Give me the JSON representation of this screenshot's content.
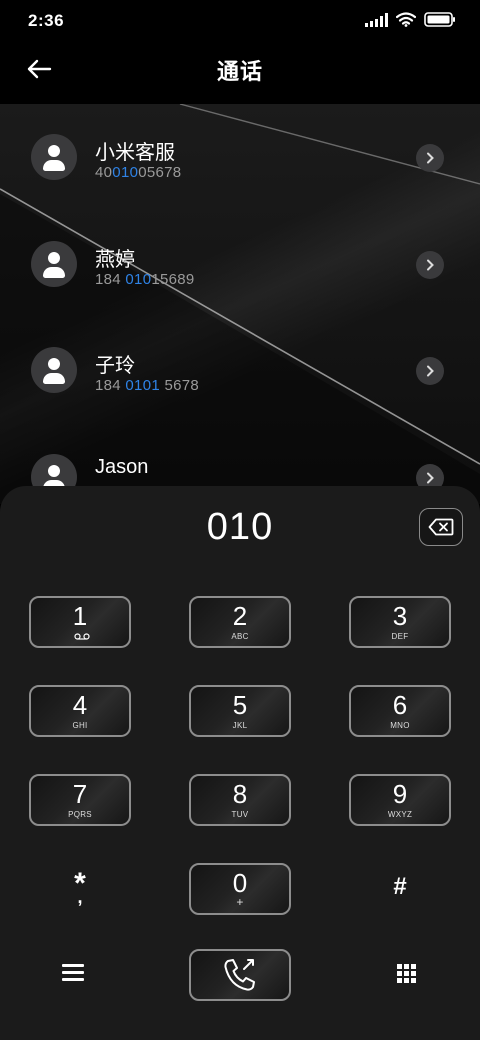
{
  "status_bar": {
    "time": "2:36"
  },
  "header": {
    "title": "通话"
  },
  "contacts": [
    {
      "name": "小米客服",
      "number_prefix": "40",
      "number_match": "010",
      "number_suffix": "05678"
    },
    {
      "name": "燕婷",
      "number_prefix": "184 ",
      "number_match": "010",
      "number_suffix": "15689"
    },
    {
      "name": "子玲",
      "number_prefix": "184 ",
      "number_match": "0101",
      "number_suffix": " 5678"
    },
    {
      "name": "Jason",
      "number_prefix": "",
      "number_match": "",
      "number_suffix": ""
    }
  ],
  "dialer": {
    "display_number": "010",
    "keys": [
      {
        "digit": "1",
        "letters": ""
      },
      {
        "digit": "2",
        "letters": "ABC"
      },
      {
        "digit": "3",
        "letters": "DEF"
      },
      {
        "digit": "4",
        "letters": "GHI"
      },
      {
        "digit": "5",
        "letters": "JKL"
      },
      {
        "digit": "6",
        "letters": "MNO"
      },
      {
        "digit": "7",
        "letters": "PQRS"
      },
      {
        "digit": "8",
        "letters": "TUV"
      },
      {
        "digit": "9",
        "letters": "WXYZ"
      },
      {
        "digit": "0",
        "letters": "+"
      }
    ],
    "star_symbol": "*",
    "hash_symbol": "#"
  },
  "colors": {
    "background": "#000000",
    "panel": "#1b1b1b",
    "match_highlight": "#2f83e6",
    "secondary_text": "#9a9a9a"
  },
  "icons": [
    "back-arrow-icon",
    "signal-icon",
    "wifi-icon",
    "battery-icon",
    "person-icon",
    "chevron-right-icon",
    "backspace-icon",
    "voicemail-icon",
    "phone-call-icon",
    "menu-icon",
    "dialpad-icon"
  ]
}
